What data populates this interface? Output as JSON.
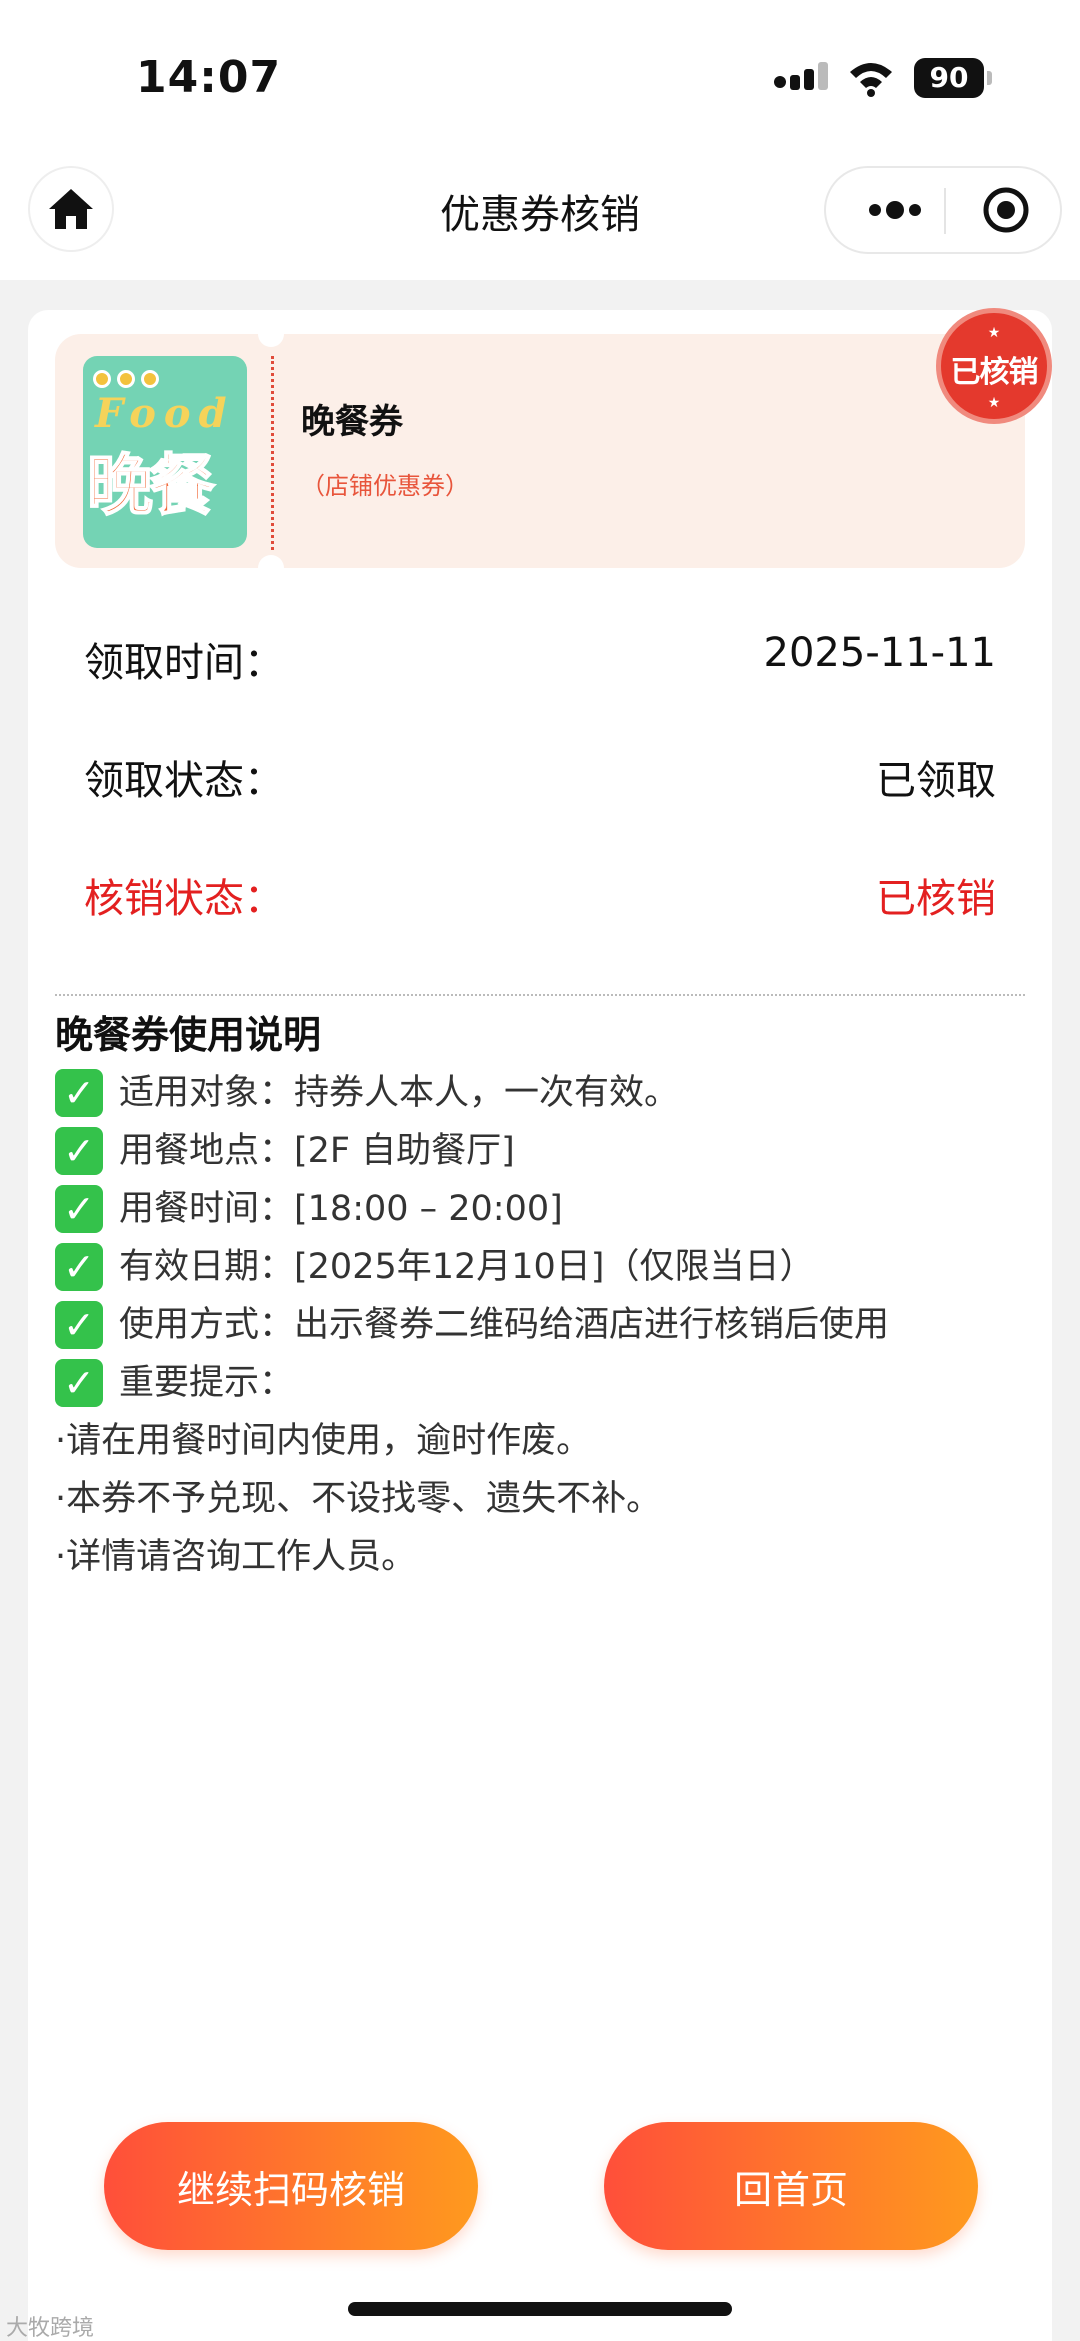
{
  "status_bar": {
    "time": "14:07",
    "battery": "90"
  },
  "nav": {
    "title": "优惠券核销"
  },
  "coupon": {
    "name": "晚餐券",
    "subtitle": "（店铺优惠券）",
    "image_text_top": "Food",
    "image_text_main": "晚餐",
    "stamp_text": "已核销"
  },
  "details": [
    {
      "label": "领取时间：",
      "value": "2025-11-11"
    },
    {
      "label": "领取状态：",
      "value": "已领取"
    },
    {
      "label": "核销状态：",
      "value": "已核销"
    }
  ],
  "instructions": {
    "title": "晚餐券使用说明",
    "check_lines": [
      "适用对象：持券人本人，一次有效。",
      "用餐地点：[2F 自助餐厅]",
      "用餐时间：[18:00 – 20:00]",
      "有效日期：[2025年12月10日]（仅限当日）",
      "使用方式：出示餐券二维码给酒店进行核销后使用",
      "重要提示："
    ],
    "bullet_lines": [
      "·请在用餐时间内使用，逾时作废。",
      "·本券不予兑现、不设找零、遗失不补。",
      "·详情请咨询工作人员。"
    ]
  },
  "buttons": {
    "continue_scan": "继续扫码核销",
    "home": "回首页"
  },
  "watermark": "大牧跨境",
  "colors": {
    "accent_red": "#e32020",
    "button_start": "#ff4f3a",
    "button_end": "#ff9a1e",
    "coupon_bg": "#fcefe8"
  }
}
